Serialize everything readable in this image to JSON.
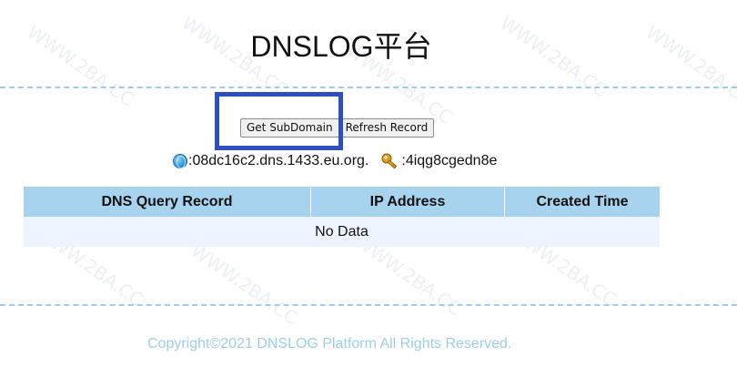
{
  "title": "DNSLOG平台",
  "buttons": {
    "get_subdomain": "Get SubDomain",
    "refresh_record": "Refresh Record"
  },
  "info": {
    "domain": ":08dc16c2.dns.1433.eu.org.",
    "token": ":4iqg8cgedn8e",
    "domain_icon": "globe-icon",
    "token_icon": "key-icon"
  },
  "table": {
    "headers": [
      "DNS Query Record",
      "IP Address",
      "Created Time"
    ],
    "empty_text": "No Data"
  },
  "footer": "Copyright©2021 DNSLOG Platform All Rights Reserved.",
  "watermark": "WWW.2BA.CC",
  "colors": {
    "header_bg": "#a7d3ef",
    "row_bg": "#eef4fe",
    "dash": "#9ccdea",
    "highlight": "#2e4fbf",
    "footer_text": "#9ccdea"
  }
}
